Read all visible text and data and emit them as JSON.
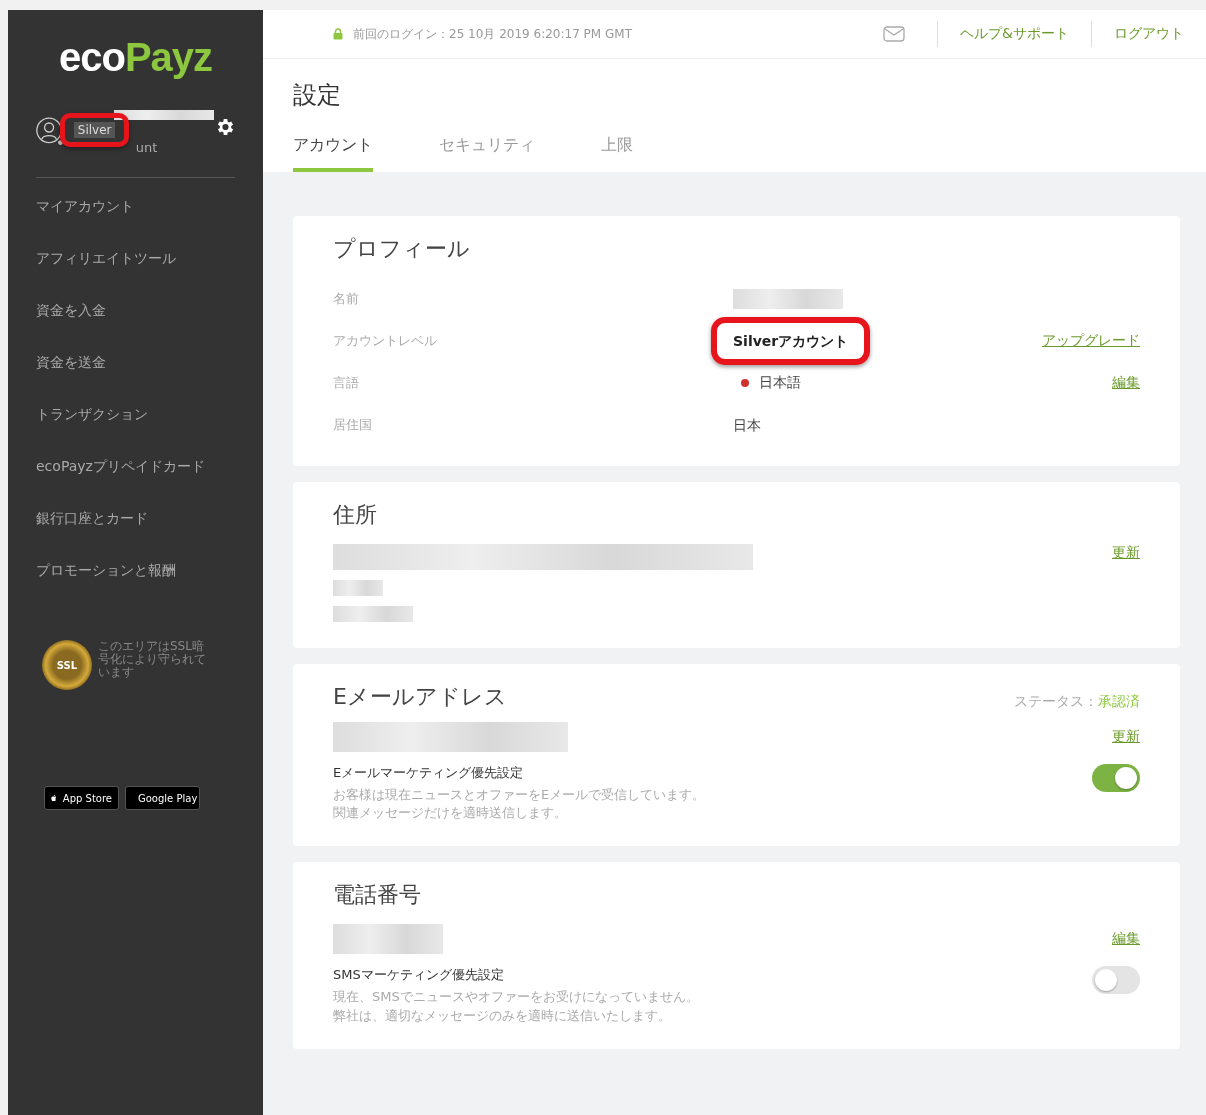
{
  "header": {
    "last_login": "前回のログイン：25 10月 2019 6:20:17 PM GMT",
    "links": [
      "ヘルプ&サポート",
      "ログアウト"
    ]
  },
  "sidebar": {
    "logo": [
      "eco",
      "Payz"
    ],
    "user": {
      "badge": "Silver",
      "highlighted": true,
      "account_type": "unt"
    },
    "nav": [
      "マイアカウント",
      "アフィリエイトツール",
      "資金を入金",
      "資金を送金",
      "トランザクション",
      "ecoPayzプリペイドカード",
      "銀行口座とカード",
      "プロモーションと報酬"
    ],
    "ssl_note": "このエリアはSSL暗号化により守られています",
    "ssl_badge": "SSL",
    "stores": [
      {
        "kind": "apple",
        "label": "App Store"
      },
      {
        "kind": "google",
        "label": "Google Play"
      }
    ]
  },
  "page": {
    "title": "設定",
    "tabs": [
      {
        "label": "アカウント",
        "selected": true
      },
      {
        "label": "セキュリティ",
        "selected": false
      },
      {
        "label": "上限",
        "selected": false
      }
    ]
  },
  "profile": {
    "title": "プロフィール",
    "rows": [
      {
        "label": "名前",
        "kind": "redacted"
      },
      {
        "label": "アカウントレベル",
        "kind": "text",
        "value": "Silverアカウント",
        "highlighted": true,
        "action": "アップグレード"
      },
      {
        "label": "言語",
        "kind": "language",
        "value": "日本語",
        "action": "編集"
      },
      {
        "label": "居住国",
        "kind": "text",
        "value": "日本",
        "highlighted": false
      }
    ]
  },
  "address": {
    "title": "住所",
    "action": "更新"
  },
  "email": {
    "title": "Eメールアドレス",
    "status_label": "ステータス：",
    "status": "承認済",
    "action": "更新",
    "pref_title": "Eメールマーケティング優先設定",
    "pref_text": [
      "お客様は現在ニュースとオファーをEメールで受信しています。",
      "関連メッセージだけを適時送信します。"
    ],
    "on": true
  },
  "phone": {
    "title": "電話番号",
    "action": "編集",
    "pref_title": "SMSマーケティング優先設定",
    "pref_text": [
      "現在、SMSでニュースやオファーをお受けになっていません。",
      "弊社は、適切なメッセージのみを適時に送信いたします。"
    ],
    "on": false
  }
}
